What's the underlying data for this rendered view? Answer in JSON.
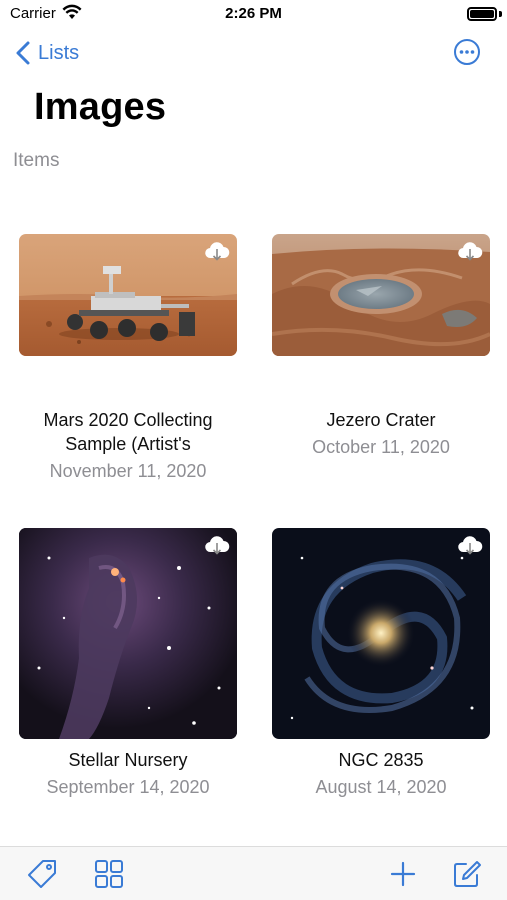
{
  "status_bar": {
    "carrier": "Carrier",
    "time": "2:26 PM"
  },
  "nav": {
    "back_label": "Lists",
    "back_icon": "chevron-left-icon",
    "more_icon": "ellipsis-circle-icon"
  },
  "page": {
    "title": "Images",
    "section": "Items"
  },
  "items": [
    {
      "title_line1": "Mars 2020 Collecting",
      "title_line2": "Sample (Artist's",
      "date": "November 11, 2020",
      "icon": "cloud-download-icon"
    },
    {
      "title_line1": "Jezero Crater",
      "title_line2": "",
      "date": "October 11, 2020",
      "icon": "cloud-download-icon"
    },
    {
      "title_line1": "Stellar Nursery",
      "title_line2": "",
      "date": "September 14, 2020",
      "icon": "cloud-download-icon"
    },
    {
      "title_line1": "NGC 2835",
      "title_line2": "",
      "date": "August 14, 2020",
      "icon": "cloud-download-icon"
    }
  ],
  "toolbar": {
    "icons": [
      "tag-icon",
      "grid-icon",
      "plus-icon",
      "compose-icon"
    ]
  },
  "colors": {
    "accent": "#3a7bd5",
    "secondary_text": "#8e8e93",
    "toolbar_bg": "#f7f7f7"
  }
}
